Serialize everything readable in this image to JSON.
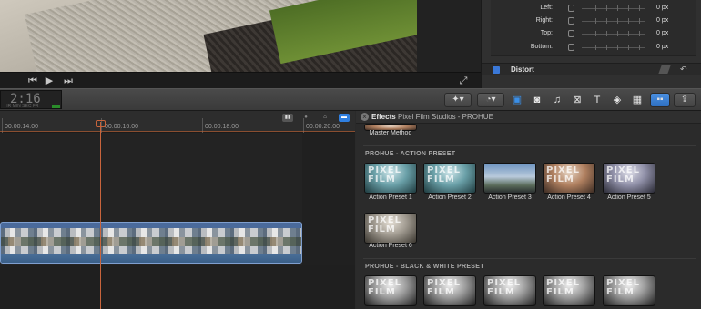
{
  "inspector": {
    "rows": [
      {
        "label": "Left:",
        "value": "0",
        "unit": "px"
      },
      {
        "label": "Right:",
        "value": "0",
        "unit": "px"
      },
      {
        "label": "Top:",
        "value": "0",
        "unit": "px"
      },
      {
        "label": "Bottom:",
        "value": "0",
        "unit": "px"
      }
    ],
    "distort_label": "Distort",
    "accent": "#3a78d8"
  },
  "viewer": {
    "controls": {
      "prev": "⏮",
      "play": "▶",
      "next": "⏭",
      "fullscreen": "⤢"
    }
  },
  "toolbar": {
    "timecode": "2:16",
    "timecode_sub": "HR MIN SEC FR",
    "icons": [
      "magic-wand-icon",
      "retime-icon",
      "video-effects-icon",
      "camera-icon",
      "music-icon",
      "transitions-icon",
      "title-icon",
      "generator-icon",
      "themes-icon",
      "effects-browser-icon",
      "share-icon"
    ]
  },
  "timeline": {
    "ruler_labels": [
      "00:00:14:00",
      "00:00:16:00",
      "00:00:18:00",
      "00:00:20:00"
    ],
    "playhead_color": "#c8643c"
  },
  "effects": {
    "title": "Effects",
    "path": "Pixel Film Studios - PROHUE",
    "top_item": "Master Method",
    "sections": [
      {
        "heading": "PROHUE - ACTION PRESET",
        "items": [
          "Action Preset 1",
          "Action Preset 2",
          "Action Preset 3",
          "Action Preset 4",
          "Action Preset 5",
          "Action Preset 6"
        ]
      },
      {
        "heading": "PROHUE - BLACK & WHITE PRESET",
        "items": [
          "",
          "",
          "",
          "",
          ""
        ]
      }
    ],
    "watermark": "PIXEL FILM STUDIOS"
  }
}
